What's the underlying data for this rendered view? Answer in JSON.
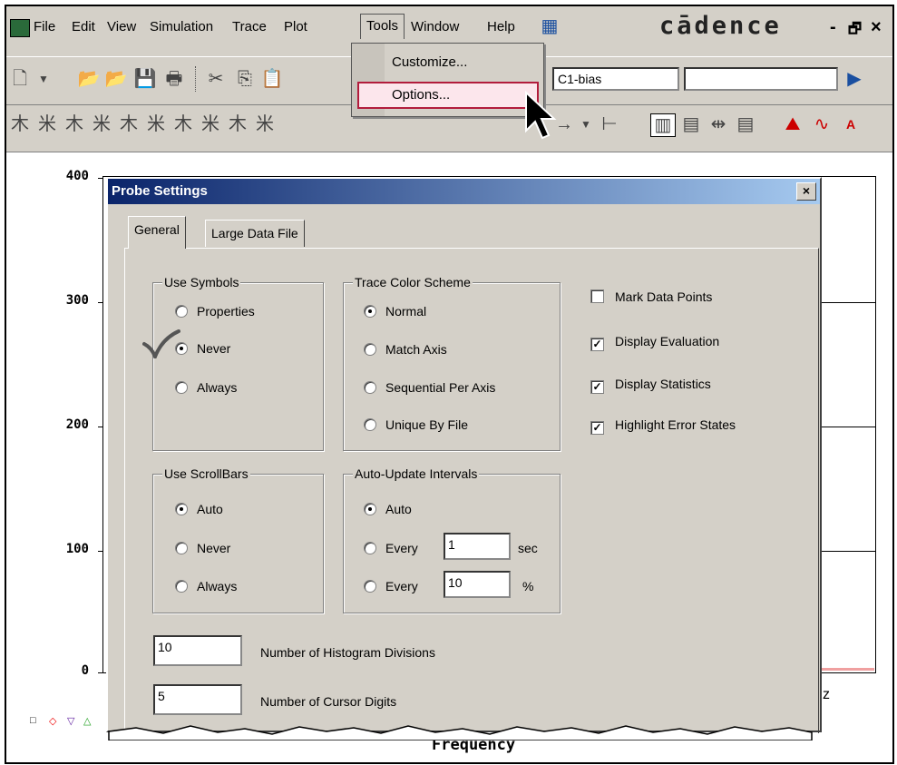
{
  "menubar": {
    "items": [
      "File",
      "Edit",
      "View",
      "Simulation",
      "Trace",
      "Plot",
      "Tools",
      "Window",
      "Help"
    ],
    "logo": "cādence",
    "window_buttons": [
      "-",
      "🗗",
      "×"
    ]
  },
  "toolbar": {
    "combo_profile": "C1-bias",
    "combo_empty": ""
  },
  "tools_menu": {
    "items": [
      "Customize...",
      "Options..."
    ],
    "highlighted": "Options..."
  },
  "plot": {
    "y_ticks": [
      "400",
      "300",
      "200",
      "100",
      "0"
    ],
    "x_label": "Frequency",
    "x_unit_fragment": "z",
    "legend_symbols": [
      "□",
      "◇",
      "▽",
      "△"
    ]
  },
  "dialog": {
    "title": "Probe Settings",
    "close": "×",
    "tabs": [
      "General",
      "Large Data File"
    ],
    "use_symbols": {
      "title": "Use Symbols",
      "options": [
        "Properties",
        "Never",
        "Always"
      ],
      "selected": "Never"
    },
    "trace_color": {
      "title": "Trace Color Scheme",
      "options": [
        "Normal",
        "Match Axis",
        "Sequential Per Axis",
        "Unique By File"
      ],
      "selected": "Normal"
    },
    "use_scrollbars": {
      "title": "Use ScrollBars",
      "options": [
        "Auto",
        "Never",
        "Always"
      ],
      "selected": "Auto"
    },
    "auto_update": {
      "title": "Auto-Update Intervals",
      "options": [
        "Auto",
        "Every",
        "Every"
      ],
      "selected": "Auto",
      "every_sec_value": "1",
      "every_sec_unit": "sec",
      "every_pct_value": "10",
      "every_pct_unit": "%"
    },
    "checkboxes": [
      {
        "label": "Mark Data Points",
        "checked": false
      },
      {
        "label": "Display Evaluation",
        "checked": true
      },
      {
        "label": "Display Statistics",
        "checked": true
      },
      {
        "label": "Highlight Error States",
        "checked": true
      }
    ],
    "histogram_divisions": {
      "value": "10",
      "label": "Number of Histogram Divisions"
    },
    "cursor_digits": {
      "value": "5",
      "label": "Number of Cursor Digits"
    }
  },
  "colors": {
    "title_start": "#0a246a",
    "title_end": "#a6caf0",
    "highlight_border": "#b21c3c",
    "highlight_fill": "#fce6ec"
  }
}
